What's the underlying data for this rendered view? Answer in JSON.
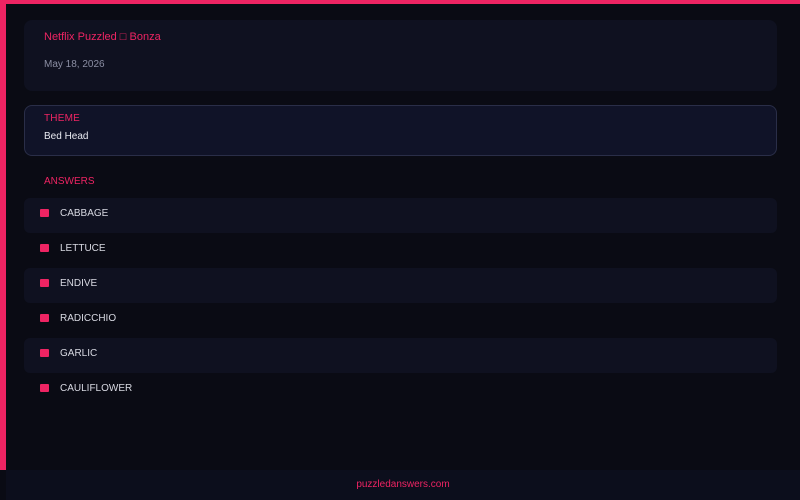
{
  "header": {
    "title": "Netflix Puzzled □ Bonza",
    "date": "May 18, 2026"
  },
  "theme": {
    "label": "THEME",
    "value": "Bed Head"
  },
  "answers": {
    "label": "ANSWERS",
    "items": [
      {
        "text": "CABBAGE"
      },
      {
        "text": "LETTUCE"
      },
      {
        "text": "ENDIVE"
      },
      {
        "text": "RADICCHIO"
      },
      {
        "text": "GARLIC"
      },
      {
        "text": "CAULIFLOWER"
      }
    ]
  },
  "footer": {
    "link": "puzzledanswers.com"
  },
  "colors": {
    "accent": "#ee2463",
    "background": "#0a0b14",
    "card": "#0f1120"
  }
}
